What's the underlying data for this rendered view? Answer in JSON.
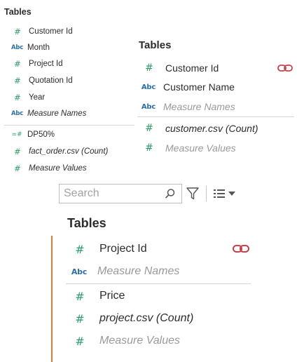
{
  "panel_small": {
    "title": "Tables",
    "fields": [
      {
        "icon": "#",
        "label": "Customer Id"
      },
      {
        "icon": "Abc",
        "label": "Month"
      },
      {
        "icon": "#",
        "label": "Project Id"
      },
      {
        "icon": "#",
        "label": "Quotation Id"
      },
      {
        "icon": "#",
        "label": "Year"
      },
      {
        "icon": "Abc",
        "label": "Measure Names"
      },
      {
        "icon": "=#",
        "label": "DP50%"
      },
      {
        "icon": "#",
        "label": "fact_order.csv (Count)"
      },
      {
        "icon": "#",
        "label": "Measure Values"
      }
    ]
  },
  "panel_medium": {
    "title": "Tables",
    "fields": [
      {
        "icon": "#",
        "label": "Customer Id"
      },
      {
        "icon": "Abc",
        "label": "Customer Name"
      },
      {
        "icon": "Abc",
        "label": "Measure Names"
      },
      {
        "icon": "#",
        "label": "customer.csv (Count)"
      },
      {
        "icon": "#",
        "label": "Measure Values"
      }
    ]
  },
  "toolbar": {
    "search_placeholder": "Search"
  },
  "panel_large": {
    "title": "Tables",
    "fields": [
      {
        "icon": "#",
        "label": "Project Id"
      },
      {
        "icon": "Abc",
        "label": "Measure Names"
      },
      {
        "icon": "#",
        "label": "Price"
      },
      {
        "icon": "#",
        "label": "project.csv (Count)"
      },
      {
        "icon": "#",
        "label": "Measure Values"
      }
    ]
  },
  "colors": {
    "measure_icon": "#2e9c6a",
    "dimension_icon": "#2e6fa8",
    "relationship_link": "#c8414a",
    "accent_bar": "#e07b39"
  },
  "icons": {
    "relationship": "link-icon",
    "search": "search-icon",
    "filter": "filter-icon",
    "view": "list-view-icon",
    "menu": "chevron-down-icon"
  }
}
